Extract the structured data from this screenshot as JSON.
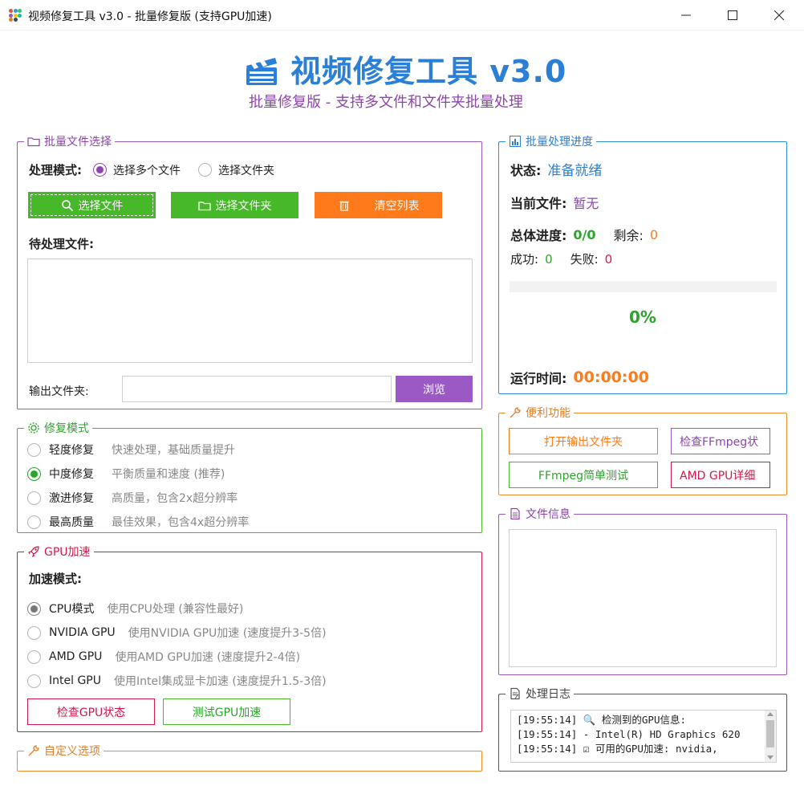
{
  "window": {
    "title": "视频修复工具 v3.0 - 批量修复版 (支持GPU加速)",
    "minimize": "—",
    "maximize": "☐",
    "close": "✕"
  },
  "header": {
    "title": "视频修复工具 v3.0",
    "subtitle": "批量修复版 - 支持多文件和文件夹批量处理"
  },
  "file_select": {
    "legend": "批量文件选择",
    "mode_label": "处理模式:",
    "mode_options": [
      "选择多个文件",
      "选择文件夹"
    ],
    "select_files_btn": "选择文件",
    "select_folder_btn": "选择文件夹",
    "clear_list_btn": "清空列表",
    "pending_label": "待处理文件:",
    "output_label": "输出文件夹:",
    "output_value": "",
    "browse_btn": "浏览"
  },
  "repair_mode": {
    "legend": "修复模式",
    "options": [
      {
        "label": "轻度修复",
        "desc": "快速处理，基础质量提升"
      },
      {
        "label": "中度修复",
        "desc": "平衡质量和速度 (推荐)"
      },
      {
        "label": "激进修复",
        "desc": "高质量，包含2x超分辨率"
      },
      {
        "label": "最高质量",
        "desc": "最佳效果，包含4x超分辨率"
      }
    ]
  },
  "gpu": {
    "legend": "GPU加速",
    "mode_label": "加速模式:",
    "options": [
      {
        "label": "CPU模式",
        "desc": "使用CPU处理 (兼容性最好)"
      },
      {
        "label": "NVIDIA GPU",
        "desc": "使用NVIDIA GPU加速 (速度提升3-5倍)"
      },
      {
        "label": "AMD GPU",
        "desc": "使用AMD GPU加速 (速度提升2-4倍)"
      },
      {
        "label": "Intel GPU",
        "desc": "使用Intel集成显卡加速 (速度提升1.5-3倍)"
      }
    ],
    "check_btn": "检查GPU状态",
    "test_btn": "测试GPU加速"
  },
  "custom": {
    "legend": "自定义选项"
  },
  "progress": {
    "legend": "批量处理进度",
    "status_label": "状态:",
    "status_value": "准备就绪",
    "current_label": "当前文件:",
    "current_value": "暂无",
    "total_label": "总体进度:",
    "total_value": "0/0",
    "remain_label": "剩余:",
    "remain_value": "0",
    "success_label": "成功:",
    "success_value": "0",
    "fail_label": "失败:",
    "fail_value": "0",
    "percent": "0%",
    "runtime_label": "运行时间:",
    "runtime_value": "00:00:00"
  },
  "tools": {
    "legend": "便利功能",
    "open_output_btn": "打开输出文件夹",
    "check_ffmpeg_btn": "检查FFmpeg状",
    "ffmpeg_test_btn": "FFmpeg简单测试",
    "amd_detail_btn": "AMD GPU详细"
  },
  "file_info": {
    "legend": "文件信息"
  },
  "log": {
    "legend": "处理日志",
    "lines": [
      {
        "time": "[19:55:14]",
        "icon": "🔍",
        "text": "检测到的GPU信息:"
      },
      {
        "time": "[19:55:14]",
        "icon": "",
        "text": "  - Intel(R) HD Graphics 620"
      },
      {
        "time": "[19:55:14]",
        "icon": "☑",
        "text": "可用的GPU加速: nvidia,"
      }
    ]
  },
  "colors": {
    "accent_blue": "#2b7fd6",
    "accent_purple": "#8e44ad",
    "accent_green": "#48b82b",
    "accent_orange": "#ff7a1a",
    "accent_red": "#d6174b"
  }
}
